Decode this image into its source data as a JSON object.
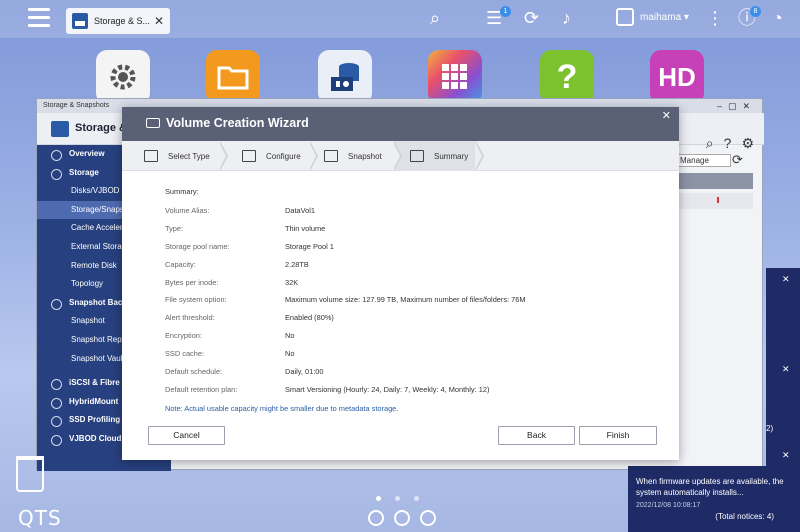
{
  "topbar": {
    "task_tab": "Storage & S...",
    "task_close": "✕",
    "user": "maihama ▾",
    "badges": {
      "notices": "1",
      "info": "8"
    }
  },
  "desktop": {
    "apps": [
      {
        "name": "settings-app",
        "icon": "gear-icon"
      },
      {
        "name": "file-station-app",
        "icon": "folder-icon"
      },
      {
        "name": "storage-snapshots-app",
        "icon": "storage-icon"
      },
      {
        "name": "app-center-app",
        "icon": "grid-icon"
      },
      {
        "name": "help-center-app",
        "icon": "question-icon",
        "glyph": "?"
      },
      {
        "name": "hd-station-app",
        "icon": "hd-icon",
        "glyph": "HD"
      }
    ],
    "logo": "QTS"
  },
  "bg_window": {
    "title": "Storage & Snapshots",
    "header_title": "Storage &",
    "manage_label": "Manage",
    "sidebar": [
      {
        "label": "Overview",
        "type": "parent"
      },
      {
        "label": "Storage",
        "type": "parent"
      },
      {
        "label": "Disks/VJBOD",
        "type": "child"
      },
      {
        "label": "Storage/Snapshots",
        "type": "child",
        "active": true
      },
      {
        "label": "Cache Acceleration",
        "type": "child"
      },
      {
        "label": "External Storage",
        "type": "child"
      },
      {
        "label": "Remote Disk",
        "type": "child"
      },
      {
        "label": "Topology",
        "type": "child"
      },
      {
        "label": "Snapshot Backup",
        "type": "parent"
      },
      {
        "label": "Snapshot",
        "type": "child"
      },
      {
        "label": "Snapshot Replica",
        "type": "child"
      },
      {
        "label": "Snapshot Vault",
        "type": "child"
      },
      {
        "label": "iSCSI & Fibre Channel",
        "type": "parent"
      },
      {
        "label": "HybridMount",
        "type": "parent"
      },
      {
        "label": "SSD Profiling Tool",
        "type": "parent"
      },
      {
        "label": "VJBOD Cloud",
        "type": "parent"
      }
    ]
  },
  "notification": {
    "text": "When firmware updates are available, the system automatically installs...",
    "time": "2022/12/08 10:08:17",
    "total": "(Total notices: 4)",
    "side_values": [
      "2)",
      "2)"
    ]
  },
  "wizard": {
    "title": "Volume Creation Wizard",
    "close": "✕",
    "steps": [
      "Select Type",
      "Configure",
      "Snapshot",
      "Summary"
    ],
    "summary_heading": "Summary:",
    "rows": [
      {
        "key": "Volume Alias:",
        "value": "DataVol1"
      },
      {
        "key": "Type:",
        "value": "Thin volume"
      },
      {
        "key": "Storage pool name:",
        "value": "Storage Pool 1"
      },
      {
        "key": "Capacity:",
        "value": "2.28TB"
      },
      {
        "key": "Bytes per inode:",
        "value": "32K"
      },
      {
        "key": "File system option:",
        "value": "Maximum volume size: 127.99 TB, Maximum number of files/folders: 76M"
      },
      {
        "key": "Alert threshold:",
        "value": "Enabled (80%)"
      },
      {
        "key": "Encryption:",
        "value": "No"
      },
      {
        "key": "SSD cache:",
        "value": "No"
      },
      {
        "key": "Default schedule:",
        "value": "Daily, 01:00"
      },
      {
        "key": "Default retention plan:",
        "value": "Smart Versioning (Hourly: 24, Daily: 7, Weekly: 4, Monthly: 12)"
      }
    ],
    "note": "Note: Actual usable capacity might be smaller due to metadata storage.",
    "buttons": {
      "cancel": "Cancel",
      "back": "Back",
      "finish": "Finish"
    }
  }
}
